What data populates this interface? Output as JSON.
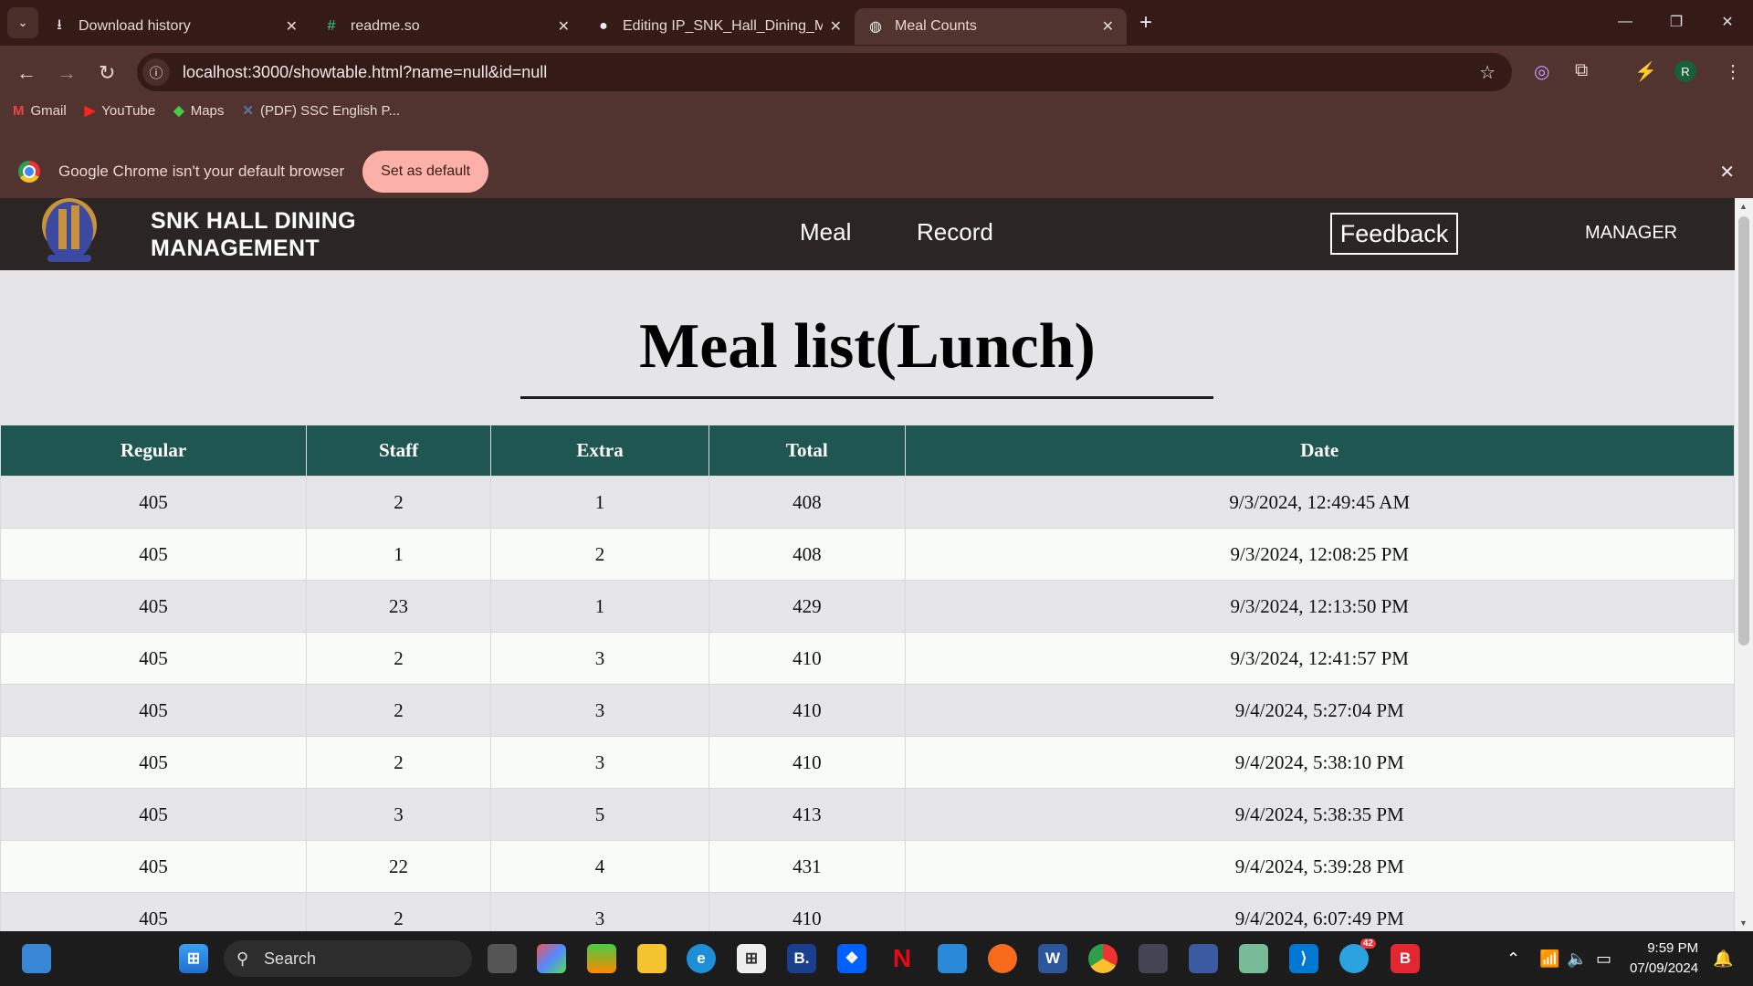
{
  "browser": {
    "tabs": [
      {
        "label": "Download history",
        "icon": "download-icon",
        "active": false
      },
      {
        "label": "readme.so",
        "icon": "readme-icon",
        "active": false
      },
      {
        "label": "Editing IP_SNK_Hall_Dining_Ma",
        "icon": "github-icon",
        "active": false
      },
      {
        "label": "Meal Counts",
        "icon": "globe-icon",
        "active": true
      }
    ],
    "url": "localhost:3000/showtable.html?name=null&id=null",
    "profile_initial": "R",
    "bookmarks": [
      {
        "label": "Gmail",
        "icon": "gmail-icon"
      },
      {
        "label": "YouTube",
        "icon": "youtube-icon"
      },
      {
        "label": "Maps",
        "icon": "maps-icon"
      },
      {
        "label": "(PDF) SSC English P...",
        "icon": "pdf-site-icon"
      }
    ],
    "infobar": {
      "message": "Google Chrome isn't your default browser",
      "button": "Set as default"
    }
  },
  "site": {
    "brand_line1": "SNK HALL DINING",
    "brand_line2": "MANAGEMENT",
    "nav": [
      "Meal",
      "Record"
    ],
    "feedback": "Feedback",
    "user": "MANAGER",
    "page_title": "Meal list(Lunch)",
    "accent": "#1f5652"
  },
  "table": {
    "columns": [
      "Regular",
      "Staff",
      "Extra",
      "Total",
      "Date"
    ],
    "rows": [
      [
        "405",
        "2",
        "1",
        "408",
        "9/3/2024, 12:49:45 AM"
      ],
      [
        "405",
        "1",
        "2",
        "408",
        "9/3/2024, 12:08:25 PM"
      ],
      [
        "405",
        "23",
        "1",
        "429",
        "9/3/2024, 12:13:50 PM"
      ],
      [
        "405",
        "2",
        "3",
        "410",
        "9/3/2024, 12:41:57 PM"
      ],
      [
        "405",
        "2",
        "3",
        "410",
        "9/4/2024, 5:27:04 PM"
      ],
      [
        "405",
        "2",
        "3",
        "410",
        "9/4/2024, 5:38:10 PM"
      ],
      [
        "405",
        "3",
        "5",
        "413",
        "9/4/2024, 5:38:35 PM"
      ],
      [
        "405",
        "22",
        "4",
        "431",
        "9/4/2024, 5:39:28 PM"
      ],
      [
        "405",
        "2",
        "3",
        "410",
        "9/4/2024, 6:07:49 PM"
      ]
    ]
  },
  "taskbar": {
    "search": "Search",
    "telegram_badge": "42",
    "time": "9:59 PM",
    "date": "07/09/2024"
  }
}
